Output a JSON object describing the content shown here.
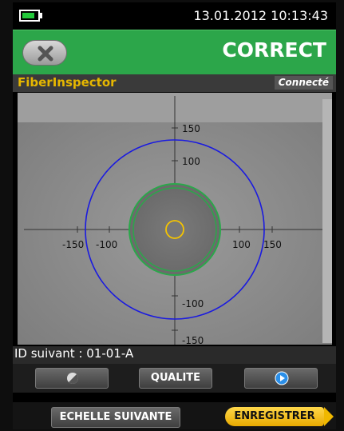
{
  "status": {
    "datetime": "13.01.2012 10:13:43",
    "battery_icon": "battery-icon"
  },
  "header": {
    "title": "CORRECT",
    "close_icon": "close-icon"
  },
  "subheader": {
    "app_name": "FiberInspector",
    "connection_status": "Connecté"
  },
  "view": {
    "x_ticks": [
      "-150",
      "-100",
      "100",
      "150"
    ],
    "y_ticks": [
      "150",
      "100",
      "-100",
      "-150"
    ]
  },
  "id_line": "ID suivant : 01-01-A",
  "buttons": {
    "brightness_icon": "contrast-icon",
    "quality_label": "QUALITE",
    "play_icon": "play-icon"
  },
  "bottom": {
    "next_scale_label": "ECHELLE SUIVANTE",
    "save_label": "ENREGISTRER"
  },
  "colors": {
    "header_green": "#2ca64a",
    "title_yellow": "#e6b700",
    "outer_ring": "#1a1ae0",
    "cladding_ring": "#2aa84a",
    "core_ring": "#f5c400"
  }
}
